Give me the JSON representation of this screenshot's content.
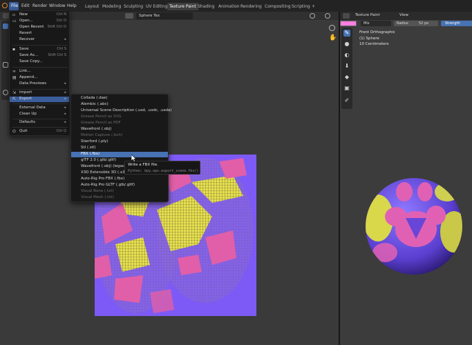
{
  "menubar": {
    "items": [
      "File",
      "Edit",
      "Render",
      "Window",
      "Help"
    ]
  },
  "workspaces": {
    "tabs": [
      "Layout",
      "Modeling",
      "Sculpting",
      "UV Editing",
      "Texture Paint",
      "Shading",
      "Animation",
      "Rendering",
      "Compositing",
      "Scripting"
    ],
    "active": "Texture Paint",
    "add_label": "+"
  },
  "image_editor": {
    "image_name": "Sphere Tex"
  },
  "file_menu": {
    "new": {
      "label": "New",
      "shortcut": "Ctrl N"
    },
    "open": {
      "label": "Open...",
      "shortcut": "Ctrl O"
    },
    "open_recent": {
      "label": "Open Recent",
      "shortcut": "Shift Ctrl O"
    },
    "revert": {
      "label": "Revert"
    },
    "recover": {
      "label": "Recover"
    },
    "save": {
      "label": "Save",
      "shortcut": "Ctrl S"
    },
    "save_as": {
      "label": "Save As...",
      "shortcut": "Shift Ctrl S"
    },
    "save_copy": {
      "label": "Save Copy..."
    },
    "link": {
      "label": "Link..."
    },
    "append": {
      "label": "Append..."
    },
    "data_previews": {
      "label": "Data Previews"
    },
    "import": {
      "label": "Import"
    },
    "export": {
      "label": "Export"
    },
    "external_data": {
      "label": "External Data"
    },
    "clean_up": {
      "label": "Clean Up"
    },
    "defaults": {
      "label": "Defaults"
    },
    "quit": {
      "label": "Quit",
      "shortcut": "Ctrl Q"
    }
  },
  "export_menu": {
    "items": [
      {
        "label": "Collada (.dae)",
        "enabled": true
      },
      {
        "label": "Alembic (.abc)",
        "enabled": true
      },
      {
        "label": "Universal Scene Description (.usd, .usdc, .usda)",
        "enabled": true
      },
      {
        "label": "Grease Pencil as SVG",
        "enabled": false
      },
      {
        "label": "Grease Pencil as PDF",
        "enabled": false
      },
      {
        "label": "Wavefront (.obj)",
        "enabled": true
      },
      {
        "label": "Motion Capture (.bvh)",
        "enabled": false
      },
      {
        "label": "Stanford (.ply)",
        "enabled": true
      },
      {
        "label": "Stl (.stl)",
        "enabled": true
      },
      {
        "label": "FBX (.fbx)",
        "enabled": true,
        "active": true
      },
      {
        "label": "glTF 2.0 (.glb/.gltf)",
        "enabled": true
      },
      {
        "label": "Wavefront (.obj) (legacy)",
        "enabled": true
      },
      {
        "label": "X3D Extensible 3D (.x3d)",
        "enabled": true
      },
      {
        "label": "Auto-Rig Pro FBX (.fbx)",
        "enabled": true
      },
      {
        "label": "Auto-Rig Pro GLTF (.glb/.gltf)",
        "enabled": true
      },
      {
        "label": "Visual Bone (.txt)",
        "enabled": false
      },
      {
        "label": "Visual Mesh (.txt)",
        "enabled": false
      }
    ]
  },
  "tooltip": {
    "description": "Write a FBX file.",
    "python": "Python: bpy.ops.export_scene.fbx()"
  },
  "paint_panel": {
    "editor_label": "Texture Paint",
    "view_label": "View",
    "blend_mode": "Mix",
    "radius_label": "Radius",
    "radius_value": "52 px",
    "strength_label": "Strength",
    "viewport_info": [
      "Front Orthographic",
      "(1) Sphere",
      "10 Centimeters"
    ],
    "brush_color": "#ff7fe0",
    "accent_color": "#4772b3"
  }
}
